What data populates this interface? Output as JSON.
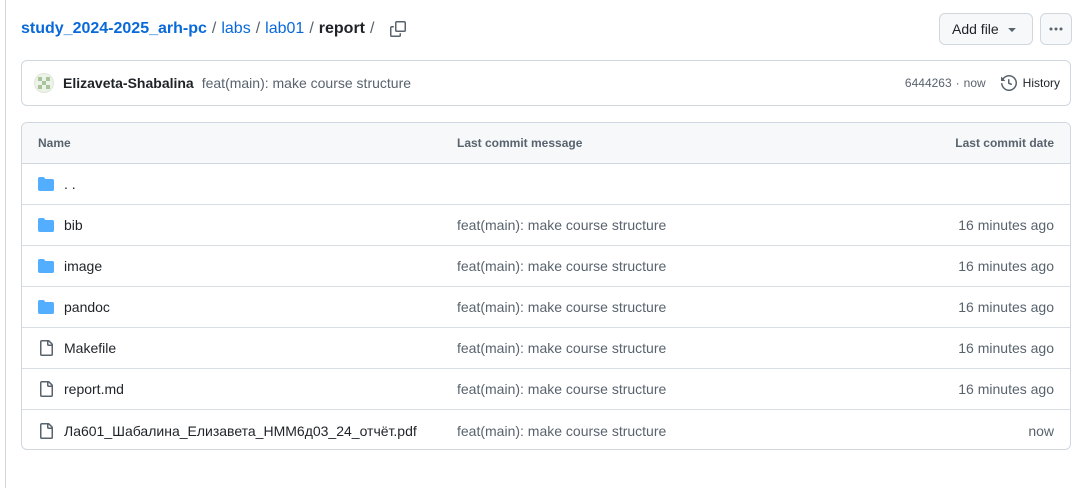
{
  "breadcrumb": {
    "repo": "study_2024-2025_arh-pc",
    "parts": [
      "labs",
      "lab01"
    ],
    "current": "report",
    "separator": "/"
  },
  "actions": {
    "add_file_label": "Add file",
    "more_label": "···"
  },
  "latest_commit": {
    "author": "Elizaveta-Shabalina",
    "message": "feat(main): make course structure",
    "sha": "6444263",
    "sep": "·",
    "time": "now",
    "history_label": "History"
  },
  "table": {
    "headers": {
      "name": "Name",
      "message": "Last commit message",
      "date": "Last commit date"
    },
    "parent": {
      "name": ". ."
    },
    "rows": [
      {
        "type": "folder",
        "name": "bib",
        "message": "feat(main): make course structure",
        "date": "16 minutes ago"
      },
      {
        "type": "folder",
        "name": "image",
        "message": "feat(main): make course structure",
        "date": "16 minutes ago"
      },
      {
        "type": "folder",
        "name": "pandoc",
        "message": "feat(main): make course structure",
        "date": "16 minutes ago"
      },
      {
        "type": "file",
        "name": "Makefile",
        "message": "feat(main): make course structure",
        "date": "16 minutes ago"
      },
      {
        "type": "file",
        "name": "report.md",
        "message": "feat(main): make course structure",
        "date": "16 minutes ago"
      },
      {
        "type": "file",
        "name": "Ла601_Шабалина_Елизавета_НММ6д03_24_отчёт.pdf",
        "message": "feat(main): make course structure",
        "date": "now"
      }
    ]
  },
  "colors": {
    "link": "#0969da",
    "folder": "#54aeff",
    "border": "#d0d7de",
    "muted": "#59636e"
  }
}
